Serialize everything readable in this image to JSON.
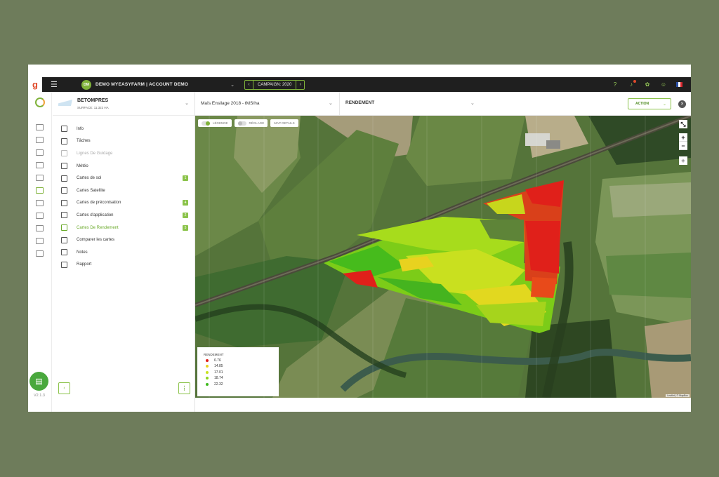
{
  "app": {
    "logo_letter": "g",
    "version": "V2.1.3"
  },
  "topbar": {
    "account_initials": "DM",
    "account_name": "DEMO MYEASYFARM | ACCOUNT DEMO",
    "campaign_label": "CAMPAIGN: 2020"
  },
  "farm": {
    "name": "BETOMPRES",
    "surface": "SURFACE: 11.322 HA"
  },
  "sidebar": {
    "items": [
      {
        "label": "Info",
        "badge": "",
        "state": "normal"
      },
      {
        "label": "Tâches",
        "badge": "",
        "state": "normal"
      },
      {
        "label": "Lignes De Guidage",
        "badge": "",
        "state": "disabled"
      },
      {
        "label": "Météo",
        "badge": "",
        "state": "normal"
      },
      {
        "label": "Cartes de sol",
        "badge": "1",
        "state": "normal"
      },
      {
        "label": "Cartes Satellite",
        "badge": "",
        "state": "normal"
      },
      {
        "label": "Cartes de préconisation",
        "badge": "4",
        "state": "normal"
      },
      {
        "label": "Cartes d'application",
        "badge": "2",
        "state": "normal"
      },
      {
        "label": "Cartes De Rendement",
        "badge": "5",
        "state": "active"
      },
      {
        "label": "Comparer les cartes",
        "badge": "",
        "state": "normal"
      },
      {
        "label": "Notes",
        "badge": "",
        "state": "normal"
      },
      {
        "label": "Rapport",
        "badge": "",
        "state": "normal"
      }
    ]
  },
  "mapheader": {
    "map_select": "Maïs Ensilage 2018 - tMS/ha",
    "layer_select": "RENDEMENT",
    "action_label": "ACTION"
  },
  "map": {
    "tabs": [
      "LÉGENDE",
      "RÉGLAGE",
      "MAP DETAILS"
    ],
    "attribution": "Leaflet | © MapBox"
  },
  "legend": {
    "title": "RENDEMENT",
    "entries": [
      {
        "value": "6.76",
        "color": "#e0201a"
      },
      {
        "value": "14.85",
        "color": "#e8d21f"
      },
      {
        "value": "17.01",
        "color": "#c9e21f"
      },
      {
        "value": "18.74",
        "color": "#8fd41f"
      },
      {
        "value": "22.32",
        "color": "#3fba1f"
      }
    ]
  },
  "colors": {
    "accent": "#8bc34a",
    "topbar": "#1f1f1f",
    "background": "#6e7c5b"
  }
}
